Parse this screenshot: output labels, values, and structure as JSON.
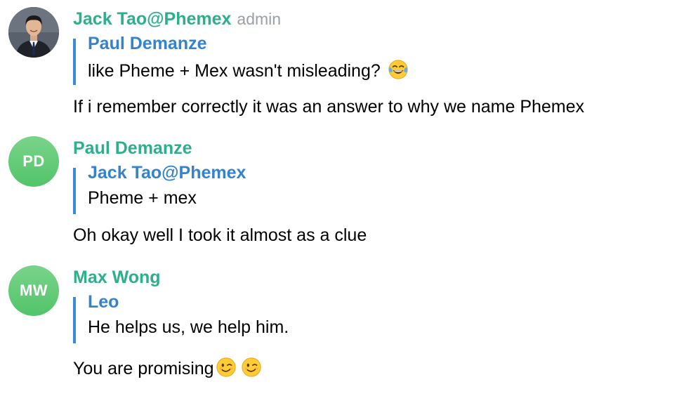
{
  "messages": [
    {
      "sender": "Jack Tao@Phemex",
      "badge": "admin",
      "avatar": {
        "type": "photo",
        "icon": "profile-photo-icon"
      },
      "reply": {
        "author": "Paul Demanze",
        "text": "like Pheme + Mex wasn't misleading?",
        "emoji": "face-with-tears-of-joy-icon"
      },
      "text": "If i remember correctly it was an answer to why we name Phemex"
    },
    {
      "sender": "Paul Demanze",
      "avatar": {
        "type": "initials",
        "initials": "PD"
      },
      "reply": {
        "author": "Jack Tao@Phemex",
        "text": "Pheme + mex"
      },
      "text": "Oh okay well I took it almost as a clue"
    },
    {
      "sender": "Max Wong",
      "avatar": {
        "type": "initials",
        "initials": "MW"
      },
      "reply": {
        "author": "Leo",
        "text": "He helps us, we help him."
      },
      "text": "You are promising",
      "emojis": [
        "winking-face-icon",
        "winking-face-icon"
      ]
    }
  ],
  "colors": {
    "sender_name": "#2dae8c",
    "reply_author": "#3483cc",
    "reply_bar": "#3b8ad9",
    "badge": "#9aa0a6",
    "avatar_green": "#5ec874"
  }
}
